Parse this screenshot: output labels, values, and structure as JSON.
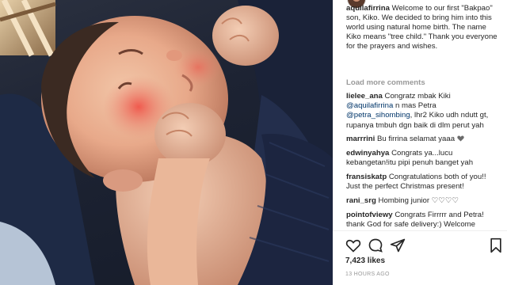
{
  "photo": {
    "alt": ""
  },
  "caption": {
    "username": "aquilafirrina",
    "text": "Welcome to our first \"Bakpao\" son, Kiko. We decided to bring him into this world using natural home birth. The name Kiko means \"tree child.\" Thank you everyone for the prayers and wishes."
  },
  "load_more": "Load more comments",
  "comments": [
    {
      "user": "lielee_ana",
      "pre": "Congratz mbak Kiki",
      "mention1": "@aquilafirrina",
      "mid": "n mas Petra",
      "mention2": "@petra_sihombing",
      "post": ", lhr2 Kiko udh ndutt gt, rupanya tmbuh dgn baik di dlm perut yah"
    },
    {
      "user": "marrrini",
      "text": "Bu firrina selamat yaaa"
    },
    {
      "user": "edwinyahya",
      "text": "Congrats ya...lucu kebangetan!itu pipi penuh banget yah"
    },
    {
      "user": "fransiskatp",
      "text": "Congratulations both of you!! Just the perfect Christmas present!"
    },
    {
      "user": "rani_srg",
      "text": "Hombing junior ♡♡♡♡"
    },
    {
      "user": "pointofviewy",
      "text": "Congrats Firrrrr and Petra! thank God for safe delivery:) Welcome"
    }
  ],
  "likes": "7,423 likes",
  "timestamp": "13 HOURS AGO",
  "icons": [
    "heart-icon",
    "comment-icon",
    "share-icon",
    "bookmark-icon"
  ]
}
